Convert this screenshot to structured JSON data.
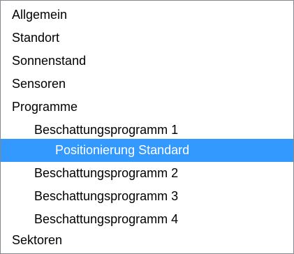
{
  "tree": {
    "items": [
      {
        "label": "Allgemein",
        "level": 0,
        "selected": false
      },
      {
        "label": "Standort",
        "level": 0,
        "selected": false
      },
      {
        "label": "Sonnenstand",
        "level": 0,
        "selected": false
      },
      {
        "label": "Sensoren",
        "level": 0,
        "selected": false
      },
      {
        "label": "Programme",
        "level": 0,
        "selected": false
      },
      {
        "label": "Beschattungsprogramm 1",
        "level": 1,
        "selected": false
      },
      {
        "label": "Positionierung Standard",
        "level": 2,
        "selected": true
      },
      {
        "label": "Beschattungsprogramm 2",
        "level": 1,
        "selected": false
      },
      {
        "label": "Beschattungsprogramm 3",
        "level": 1,
        "selected": false
      },
      {
        "label": "Beschattungsprogramm 4",
        "level": 1,
        "selected": false
      },
      {
        "label": "Sektoren",
        "level": 0,
        "selected": false
      }
    ]
  },
  "colors": {
    "selection_background": "#3399ff",
    "selection_text": "#ffffff",
    "border": "#828790"
  }
}
